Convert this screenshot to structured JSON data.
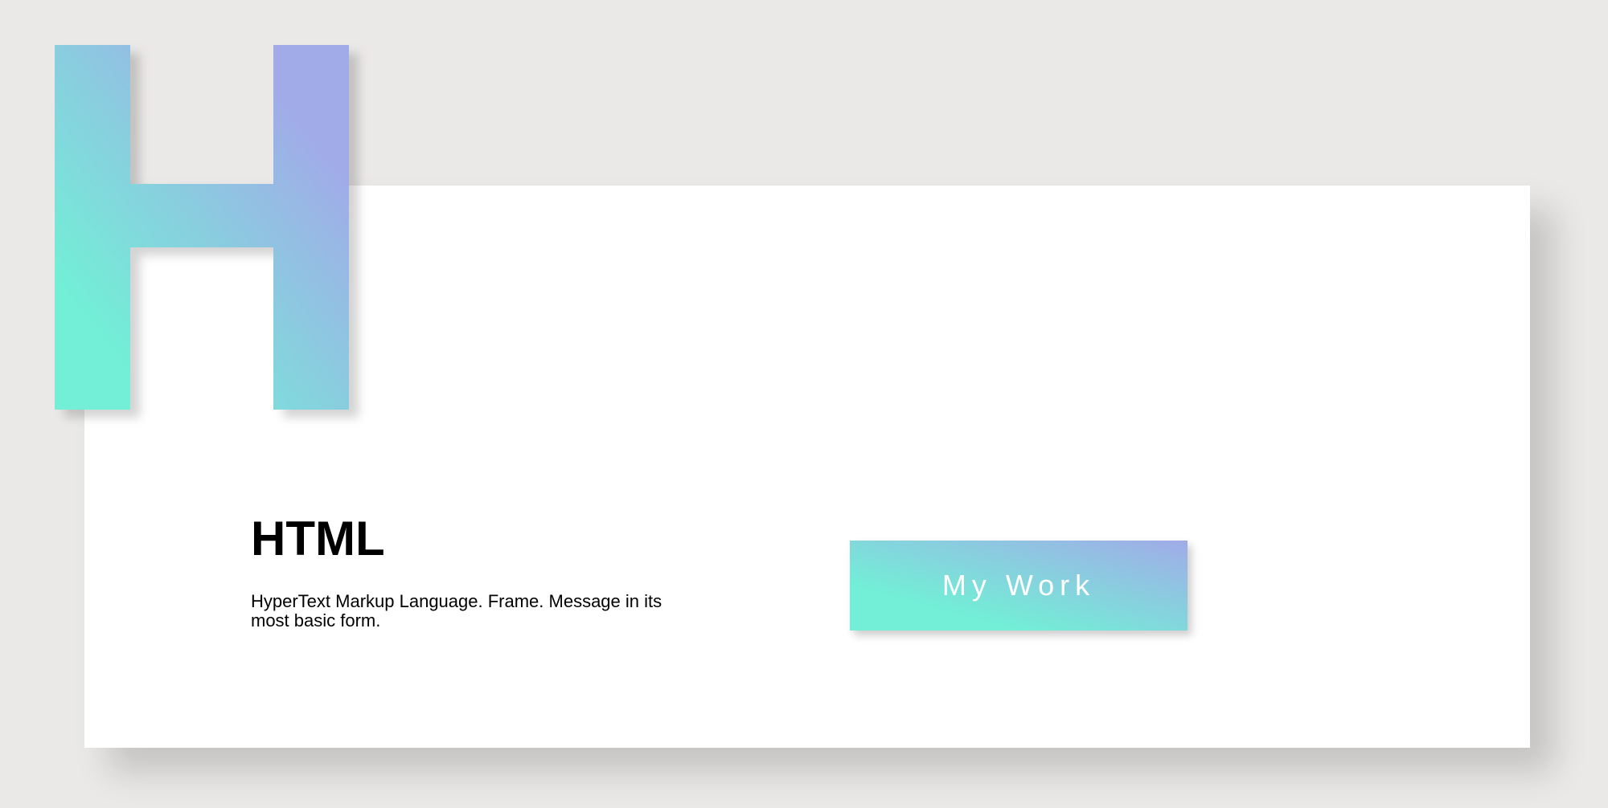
{
  "hero": {
    "letter_icon": "gradient-letter-h-icon",
    "gradient_start": "#72efd6",
    "gradient_end": "#a1abe8"
  },
  "section": {
    "title": "HTML",
    "description": "HyperText Markup Language. Frame. Message in its most basic form."
  },
  "button": {
    "label": "My Work"
  },
  "colors": {
    "background": "#eae9e7",
    "card": "#ffffff",
    "text": "#000000",
    "button_text": "#ffffff"
  }
}
